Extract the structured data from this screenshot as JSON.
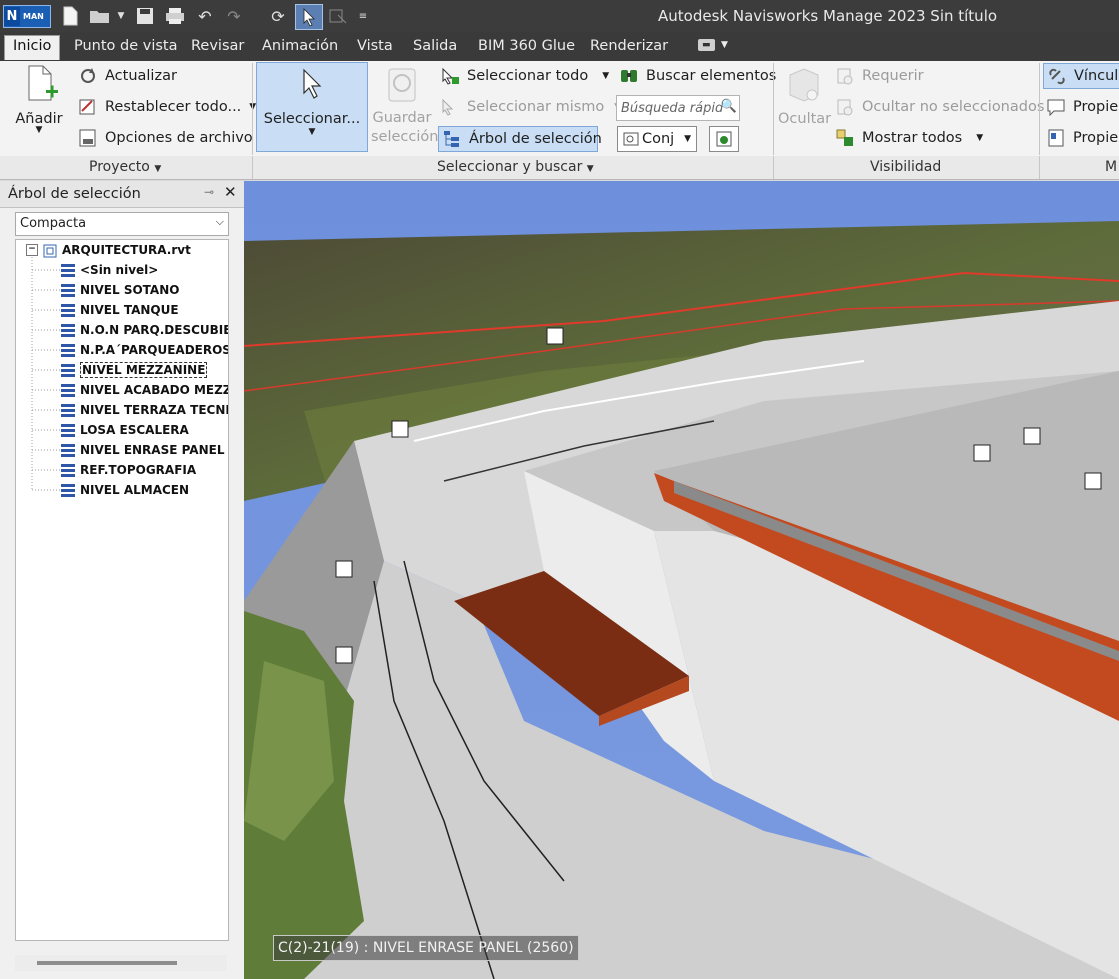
{
  "window": {
    "title": "Autodesk Navisworks Manage 2023    Sin título",
    "logo_letter": "N",
    "logo_subtext": "MAN"
  },
  "tabs": [
    {
      "label": "Inicio",
      "active": true
    },
    {
      "label": "Punto de vista"
    },
    {
      "label": "Revisar"
    },
    {
      "label": "Animación"
    },
    {
      "label": "Vista"
    },
    {
      "label": "Salida"
    },
    {
      "label": "BIM 360 Glue"
    },
    {
      "label": "Renderizar"
    }
  ],
  "ribbon": {
    "proyecto": {
      "label": "Proyecto",
      "add": "Añadir",
      "refresh": "Actualizar",
      "reset": "Restablecer todo...",
      "file_options": "Opciones de archivo"
    },
    "select": {
      "label": "Seleccionar y buscar",
      "select_btn": "Seleccionar...",
      "save_sel_1": "Guardar",
      "save_sel_2": "selección",
      "select_all": "Seleccionar todo",
      "select_same": "Seleccionar mismo",
      "selection_tree": "Árbol de selección",
      "find_items": "Buscar elementos",
      "quick_find_placeholder": "Búsqueda rápid",
      "sets": "Conj"
    },
    "visibility": {
      "label": "Visibilidad",
      "hide": "Ocultar",
      "require": "Requerir",
      "hide_unselected": "Ocultar no seleccionados",
      "show_all": "Mostrar todos"
    },
    "display": {
      "label": "M",
      "links": "Vínculo",
      "props1": "Propie",
      "props2": "Propie"
    }
  },
  "selection_tree": {
    "title": "Árbol de selección",
    "mode": "Compacta",
    "root": "ARQUITECTURA.rvt",
    "items": [
      "<Sin nivel>",
      "NIVEL SOTANO",
      "NIVEL TANQUE",
      "N.O.N PARQ.DESCUBIERT",
      "N.P.A´PARQUEADEROS",
      "NIVEL MEZZANINE",
      "NIVEL ACABADO MEZZA",
      "NIVEL TERRAZA TECNICA",
      "LOSA ESCALERA",
      "NIVEL ENRASE PANEL",
      "REF.TOPOGRAFIA",
      "NIVEL ALMACEN"
    ]
  },
  "viewport": {
    "status": "C(2)-21(19) : NIVEL ENRASE PANEL (2560)"
  },
  "colors": {
    "titlebar": "#3c3c3c",
    "ribbon": "#f3f3f3",
    "accent": "#1a5fb4",
    "selected_button": "#c9def5",
    "roof_orange": "#c34a1f"
  }
}
